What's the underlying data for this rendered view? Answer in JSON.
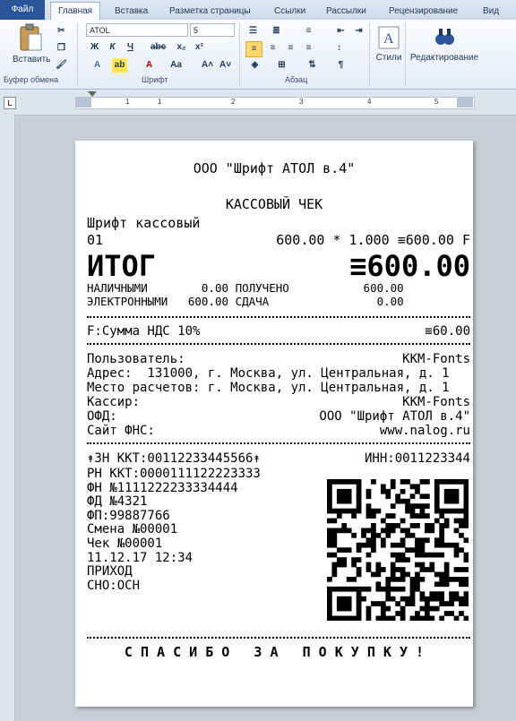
{
  "ribbon_tabs": [
    "Файл",
    "Главная",
    "Вставка",
    "Разметка страницы",
    "Ссылки",
    "Рассылки",
    "Рецензирование",
    "Вид"
  ],
  "clipboard": {
    "paste_label": "Вставить",
    "group_label": "Буфер обмена"
  },
  "font": {
    "name": "ATOL",
    "size": "5",
    "group_label": "Шрифт"
  },
  "paragraph": {
    "group_label": "Абзац"
  },
  "styles": {
    "label": "Стили"
  },
  "editing": {
    "label": "Редактирование"
  },
  "ruler_numbers": [
    "1",
    "1",
    "2",
    "3",
    "4",
    "5"
  ],
  "receipt": {
    "header": "ООО \"Шрифт АТОЛ в.4\"",
    "doc_type": "КАССОВЫЙ ЧЕК",
    "item_name": "Шрифт кассовый",
    "item_code": "01",
    "item_calc": "600.00 * 1.000 ≡600.00 F",
    "total_label": "ИТОГ",
    "total_value": "≡600.00",
    "cash_line": "НАЛИЧНЫМИ        0.00 ПОЛУЧЕНО           600.00",
    "card_line": "ЭЛЕКТРОННЫМИ   600.00 СДАЧА                0.00",
    "vat_label": "F:Сумма НДС 10%",
    "vat_value": "≡60.00",
    "user_label": "Пользователь:",
    "user_value": "KKM-Fonts",
    "address": "Адрес:  131000, г. Москва, ул. Центральная, д. 1",
    "place": "Место расчетов: г. Москва, ул. Центральная, д. 1",
    "cashier_label": "Кассир:",
    "cashier_value": "KKM-Fonts",
    "ofd_label": "ОФД:",
    "ofd_value": "ООО \"Шрифт АТОЛ в.4\"",
    "site_label": "Сайт ФНС:",
    "site_value": "www.nalog.ru",
    "zn": "↟ЗН ККТ:00112233445566↟",
    "inn": "ИНН:0011223344",
    "details": [
      "РН ККТ:0000111122223333",
      "ФН №1111222233334444",
      "ФД №4321",
      "ФП:99887766",
      "Смена №00001",
      "Чек №00001",
      "11.12.17 12:34",
      "ПРИХОД",
      "СНО:ОСН"
    ],
    "thanks": "С П А С И Б О   З А   П О К У П К У !"
  }
}
